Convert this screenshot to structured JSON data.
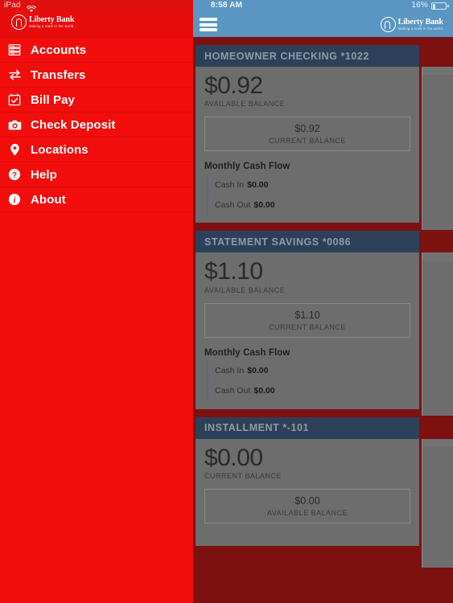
{
  "status_bar": {
    "device": "iPad",
    "wifi_icon": "wifi-icon",
    "time": "8:58 AM",
    "battery_percent": "16%",
    "battery_icon": "battery-low-icon"
  },
  "brand": {
    "name": "Liberty Bank",
    "tagline": "Making a mark in the world...",
    "logo_icon": "liberty-bank-arch-logo"
  },
  "sidebar": {
    "items": [
      {
        "label": "Accounts",
        "icon": "accounts-list-icon"
      },
      {
        "label": "Transfers",
        "icon": "transfer-arrows-icon"
      },
      {
        "label": "Bill Pay",
        "icon": "calendar-check-icon"
      },
      {
        "label": "Check Deposit",
        "icon": "camera-icon"
      },
      {
        "label": "Locations",
        "icon": "map-pin-icon"
      },
      {
        "label": "Help",
        "icon": "question-circle-icon"
      },
      {
        "label": "About",
        "icon": "info-circle-icon"
      }
    ]
  },
  "header": {
    "menu_icon": "hamburger-menu-icon"
  },
  "accounts": [
    {
      "title": "HOMEOWNER CHECKING *1022",
      "primary_amount": "$0.92",
      "primary_label": "AVAILABLE BALANCE",
      "secondary_amount": "$0.92",
      "secondary_label": "CURRENT BALANCE",
      "cashflow_title": "Monthly Cash Flow",
      "cash_in_label": "Cash In",
      "cash_in_value": "$0.00",
      "cash_out_label": "Cash Out",
      "cash_out_value": "$0.00"
    },
    {
      "title": "STATEMENT SAVINGS *0086",
      "primary_amount": "$1.10",
      "primary_label": "AVAILABLE BALANCE",
      "secondary_amount": "$1.10",
      "secondary_label": "CURRENT BALANCE",
      "cashflow_title": "Monthly Cash Flow",
      "cash_in_label": "Cash In",
      "cash_in_value": "$0.00",
      "cash_out_label": "Cash Out",
      "cash_out_value": "$0.00"
    },
    {
      "title": "INSTALLMENT *-101",
      "primary_amount": "$0.00",
      "primary_label": "CURRENT BALANCE",
      "secondary_amount": "$0.00",
      "secondary_label": "AVAILABLE BALANCE"
    }
  ],
  "colors": {
    "sidebar_red": "#f20d0d",
    "background_red": "#7d1010",
    "card_header_navy": "#2c4159",
    "card_body_gray": "#6e6d6d",
    "header_blue": "#5b96c2"
  }
}
